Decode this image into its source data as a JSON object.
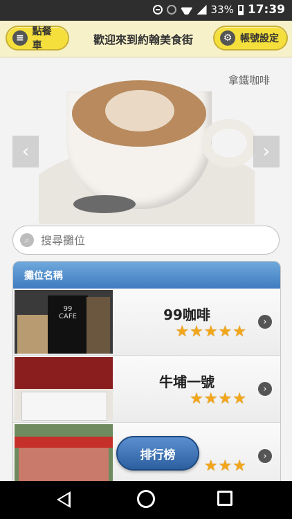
{
  "status_bar": {
    "battery": "33%",
    "time": "17:39",
    "icons": [
      "data-saver-icon",
      "alarm-icon",
      "wifi-icon",
      "signal-icon",
      "battery-icon"
    ]
  },
  "header": {
    "cart_button": "點餐車",
    "title": "歡迎來到約翰美食街",
    "account_button": "帳號設定"
  },
  "banner": {
    "caption": "拿鐵咖啡",
    "prev_icon": "chevron-left-icon",
    "next_icon": "chevron-right-icon"
  },
  "search": {
    "placeholder": "搜尋攤位",
    "value": ""
  },
  "list": {
    "header": "攤位名稱",
    "rows": [
      {
        "name": "99咖啡",
        "stars": "★★★★★",
        "rating": 5
      },
      {
        "name": "牛埔一號",
        "stars": "★★★★",
        "rating": 4
      },
      {
        "name": "",
        "stars": "★★★",
        "rating": 3
      }
    ]
  },
  "ranking_button": "排行榜",
  "colors": {
    "header_bg": "#f7f1c9",
    "header_button": "#f5df3c",
    "list_header": "#4f8cc9",
    "star": "#f2a61c",
    "fab": "#3b6fb0"
  }
}
